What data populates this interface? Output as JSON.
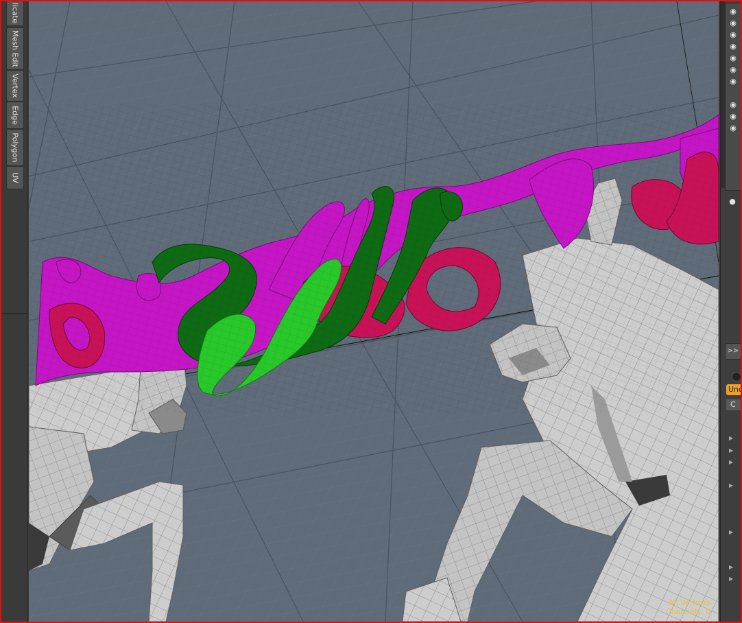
{
  "left_tabs": [
    {
      "label": "licate"
    },
    {
      "label": "Mesh Edit"
    },
    {
      "label": "Vertex"
    },
    {
      "label": "Edge"
    },
    {
      "label": "Polygon"
    },
    {
      "label": "UV"
    }
  ],
  "viewport": {
    "status_line1": "All Vertices",
    "status_line2": "Channels: 0",
    "colors": {
      "background": "#5f6b78",
      "mesh": "#c9c9c9",
      "magenta": "#c416c4",
      "crimson": "#c81257",
      "dark_green": "#0f6a14",
      "light_green": "#28c72a"
    }
  },
  "right_panel": {
    "eye_icons": 11,
    "expand_label": ">>",
    "undo_label": "Und",
    "header_label": "C"
  }
}
